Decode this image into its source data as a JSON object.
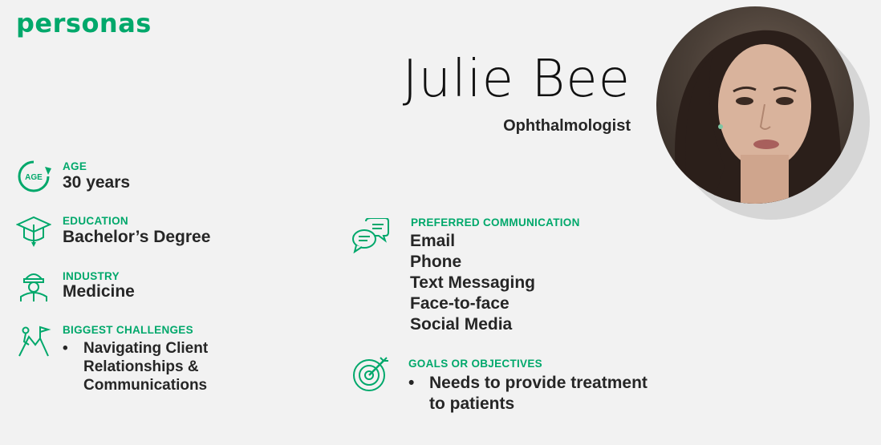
{
  "brand": "personas",
  "persona": {
    "name": "Julie Bee",
    "role": "Ophthalmologist"
  },
  "age": {
    "label": "AGE",
    "value": "30 years",
    "icon": "age-icon",
    "icon_text": "AGE"
  },
  "education": {
    "label": "EDUCATION",
    "value": "Bachelor’s Degree",
    "icon": "graduation-cap-icon"
  },
  "industry": {
    "label": "INDUSTRY",
    "value": "Medicine",
    "icon": "worker-icon"
  },
  "challenges": {
    "label": "BIGGEST CHALLENGES",
    "icon": "climber-icon",
    "items": [
      "Navigating Client Relationships & Communications"
    ]
  },
  "communication": {
    "label": "PREFERRED COMMUNICATION",
    "icon": "chat-bubbles-icon",
    "items": [
      "Email",
      "Phone",
      "Text Messaging",
      "Face-to-face",
      "Social Media"
    ]
  },
  "goals": {
    "label": "GOALS OR OBJECTIVES",
    "icon": "target-icon",
    "items": [
      "Needs to provide treatment to patients"
    ]
  },
  "colors": {
    "accent": "#00a86b",
    "text": "#262626",
    "background": "#f2f2f2"
  }
}
